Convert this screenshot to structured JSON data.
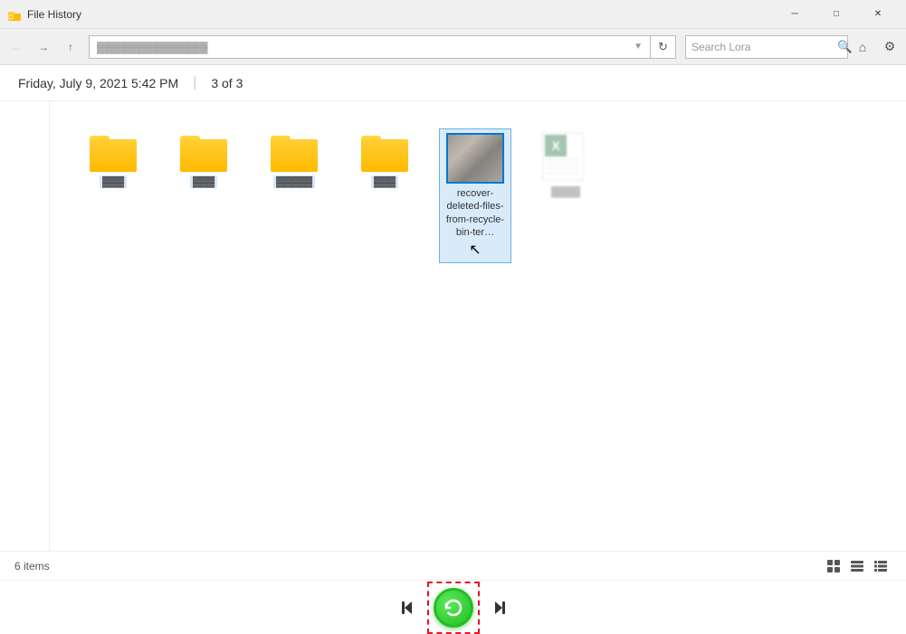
{
  "titlebar": {
    "icon": "📁",
    "title": "File History",
    "minimize_label": "─",
    "maximize_label": "□",
    "close_label": "✕"
  },
  "navbar": {
    "back_tooltip": "Back",
    "forward_tooltip": "Forward",
    "up_tooltip": "Up",
    "address_placeholder": "address bar path",
    "address_text": "▓▓▓▓▓▓▓▓▓▓▓▓▓▓▓▓▓",
    "refresh_icon": "↻",
    "search_placeholder": "Search Lora",
    "search_label": "Search Lora",
    "search_icon": "🔍",
    "home_icon": "⌂",
    "settings_icon": "⚙"
  },
  "datebar": {
    "date_text": "Friday, July 9, 2021 5:42 PM",
    "separator": "|",
    "page_info": "3 of 3"
  },
  "files": [
    {
      "type": "folder",
      "label": ""
    },
    {
      "type": "folder",
      "label": ""
    },
    {
      "type": "folder",
      "label": ""
    },
    {
      "type": "folder",
      "label": ""
    },
    {
      "type": "image",
      "label": "recover-deleted-files-from-recycle-bin-ter…",
      "selected": true
    },
    {
      "type": "excel",
      "label": "",
      "ghost": true
    }
  ],
  "statusbar": {
    "items_text": "6 items",
    "view_large_icon": "⊞",
    "view_list_icon": "≡",
    "view_detail_icon": "☰"
  },
  "bottomcontrols": {
    "skip_start_icon": "⏮",
    "restore_icon": "↺",
    "skip_end_icon": "⏭"
  }
}
